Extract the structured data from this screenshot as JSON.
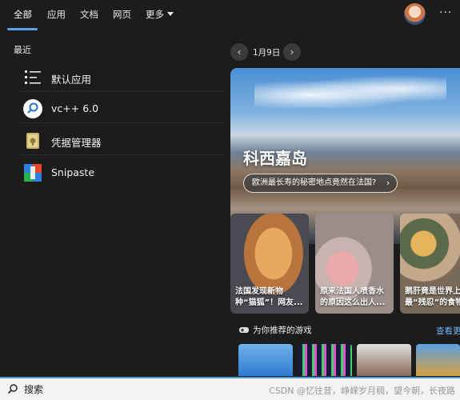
{
  "tabs": [
    {
      "label": "全部",
      "active": true
    },
    {
      "label": "应用",
      "active": false
    },
    {
      "label": "文档",
      "active": false
    },
    {
      "label": "网页",
      "active": false
    },
    {
      "label": "更多",
      "active": false
    }
  ],
  "recent": {
    "title": "最近",
    "items": [
      {
        "label": "默认应用",
        "icon": "settings-list-icon"
      },
      {
        "label": "vc++ 6.0",
        "icon": "search-circle-icon"
      },
      {
        "label": "凭据管理器",
        "icon": "credential-safe-icon"
      },
      {
        "label": "Snipaste",
        "icon": "snipaste-icon"
      }
    ]
  },
  "highlights": {
    "date": "1月9日",
    "hero": {
      "title": "科西嘉岛",
      "subtitle": "欧洲最长寿的秘密地点竟然在法国?"
    },
    "cards": [
      {
        "text": "法国发现新物\n种“猫狐”！网友..."
      },
      {
        "text": "原来法国人喷香水\n的原因这么出人..."
      },
      {
        "text": "鹅肝竟是世界上\n最“残忍”的食物"
      }
    ],
    "games": {
      "title": "为你推荐的游戏",
      "more": "查看更多"
    }
  },
  "search": {
    "placeholder": "搜索",
    "watermark": "CSDN @忆往昔，峥嵘岁月稠，望今朝，长夜路"
  },
  "colors": {
    "accent": "#4b9be0",
    "background": "#1c1c1c"
  }
}
